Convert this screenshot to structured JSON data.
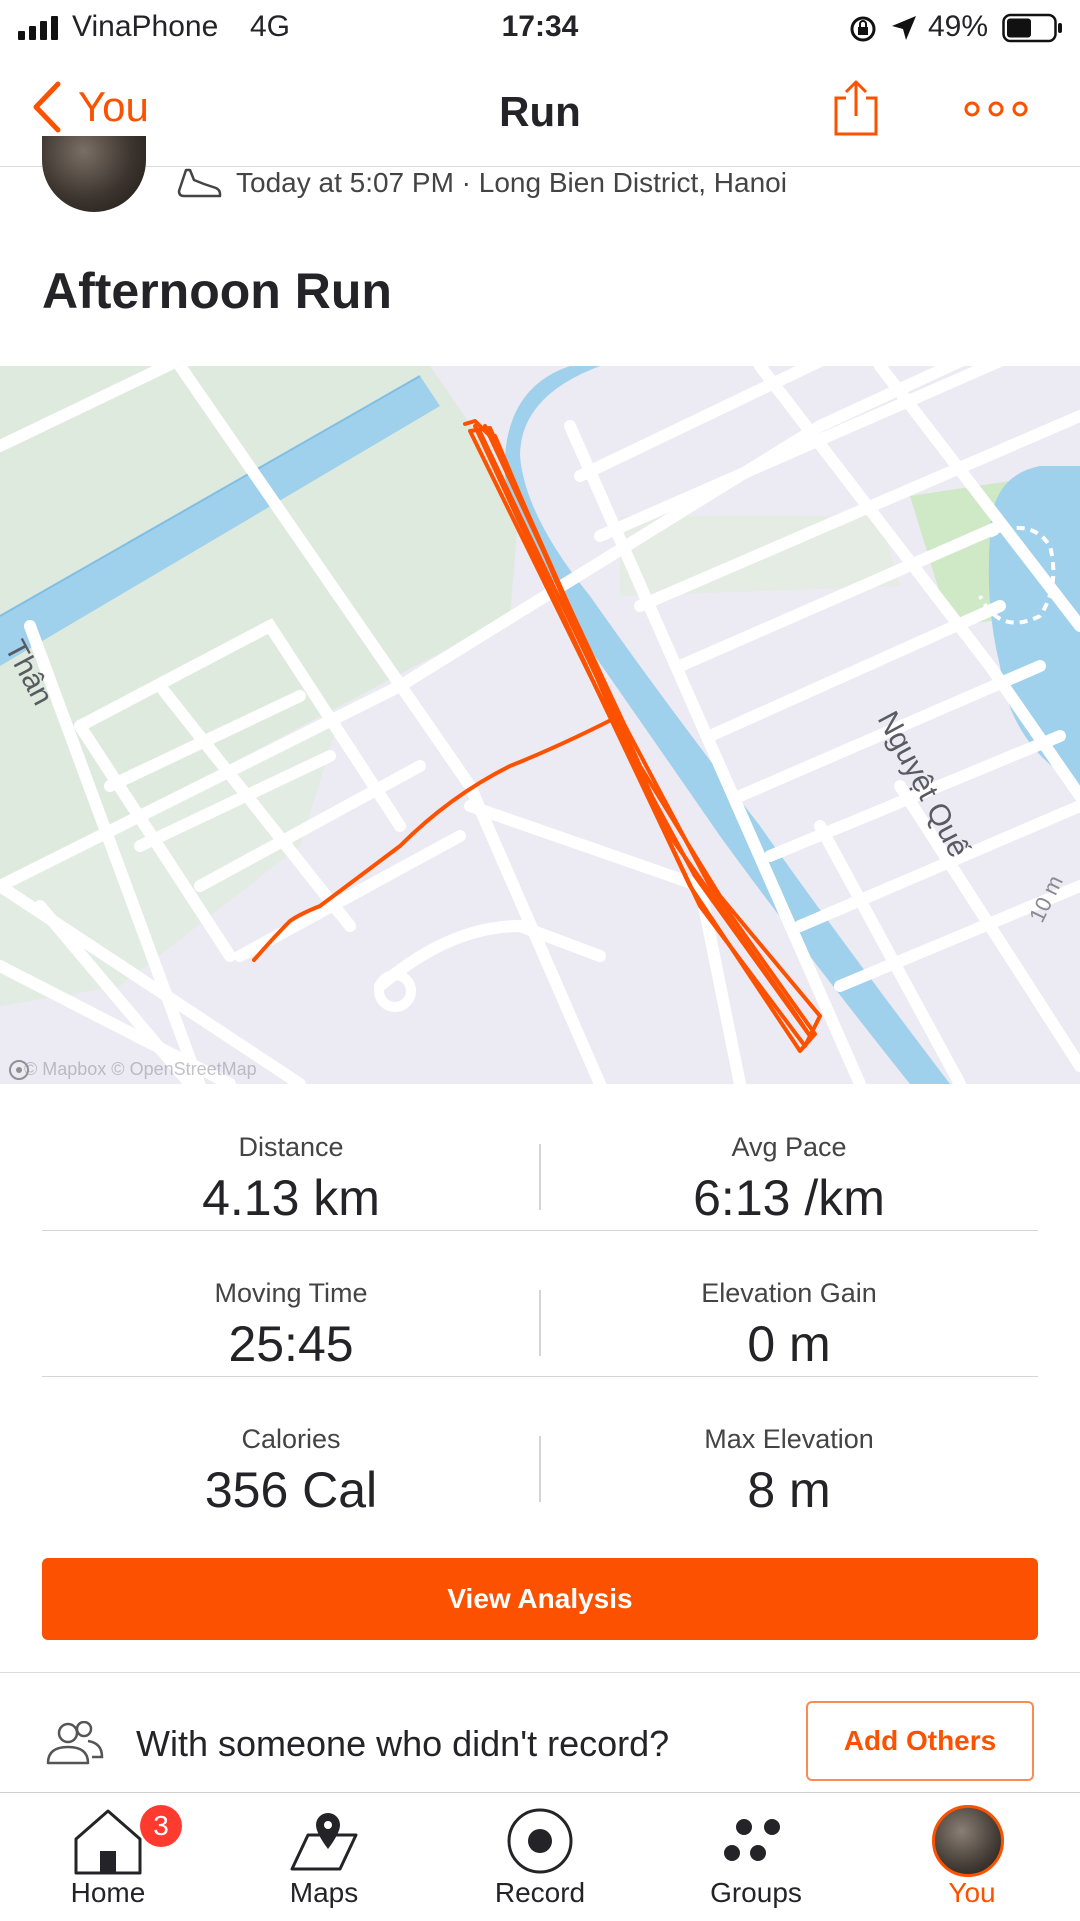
{
  "status_bar": {
    "carrier": "VinaPhone",
    "network": "4G",
    "time": "17:34",
    "battery": "49%"
  },
  "nav": {
    "back_label": "You",
    "title": "Run",
    "share_icon": "share-icon",
    "more_icon": "more-icon"
  },
  "activity": {
    "meta": "Today at 5:07 PM · Long Bien District, Hanoi",
    "title": "Afternoon Run"
  },
  "map": {
    "street_1": "Thân",
    "street_2": "Nguyệt Quế",
    "scale": "10 m",
    "attribution": "© Mapbox © OpenStreetMap",
    "route_color": "#fc5200"
  },
  "stats": [
    [
      {
        "label": "Distance",
        "value": "4.13 km"
      },
      {
        "label": "Avg Pace",
        "value": "6:13 /km"
      }
    ],
    [
      {
        "label": "Moving Time",
        "value": "25:45"
      },
      {
        "label": "Elevation Gain",
        "value": "0 m"
      }
    ],
    [
      {
        "label": "Calories",
        "value": "356 Cal"
      },
      {
        "label": "Max Elevation",
        "value": "8 m"
      }
    ]
  ],
  "actions": {
    "view_analysis": "View Analysis",
    "others_text": "With someone who didn't record?",
    "add_others": "Add Others"
  },
  "tabbar": {
    "tabs": [
      {
        "label": "Home",
        "icon": "home-icon",
        "badge": "3"
      },
      {
        "label": "Maps",
        "icon": "maps-icon"
      },
      {
        "label": "Record",
        "icon": "record-icon"
      },
      {
        "label": "Groups",
        "icon": "groups-icon"
      },
      {
        "label": "You",
        "icon": "avatar-icon",
        "active": true
      }
    ]
  },
  "colors": {
    "accent": "#fc5200",
    "text": "#242428",
    "badge": "#ff3b30"
  }
}
